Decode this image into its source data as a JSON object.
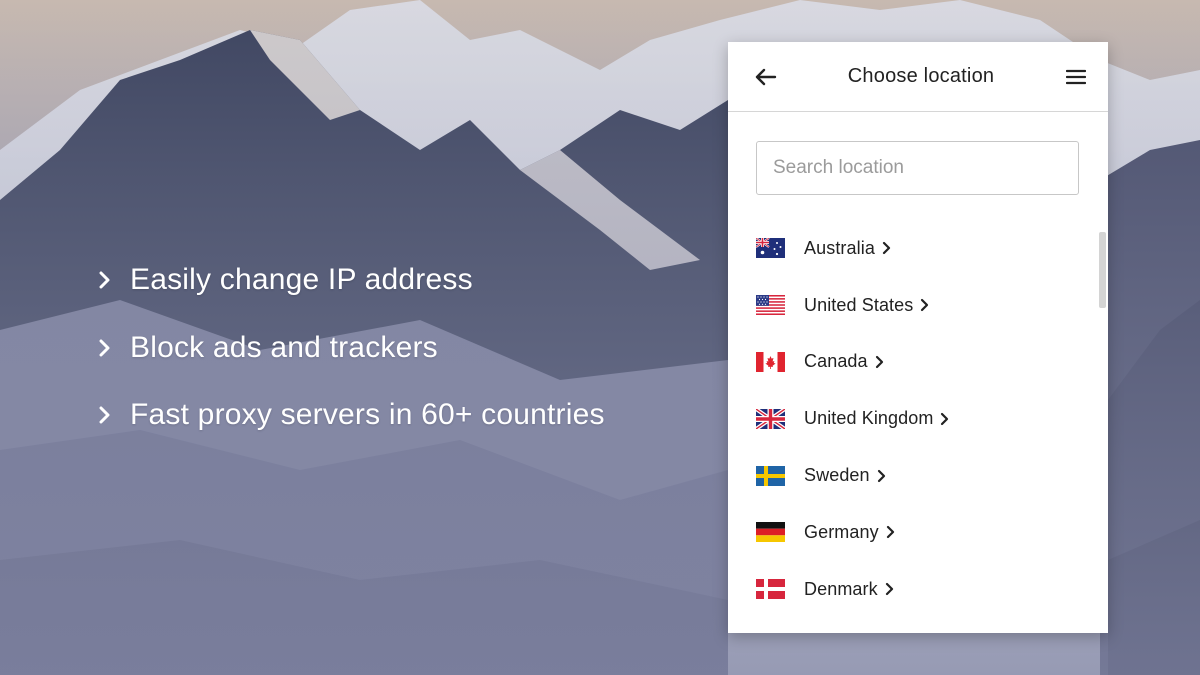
{
  "features": [
    {
      "text": "Easily change IP address"
    },
    {
      "text": "Block ads and trackers"
    },
    {
      "text": "Fast proxy servers in 60+ countries"
    }
  ],
  "panel": {
    "title": "Choose location",
    "back_icon": "arrow-left-icon",
    "menu_icon": "hamburger-menu-icon",
    "search": {
      "placeholder": "Search location",
      "value": ""
    },
    "locations": [
      {
        "name": "Australia",
        "flag": "australia-flag"
      },
      {
        "name": "United States",
        "flag": "united-states-flag"
      },
      {
        "name": "Canada",
        "flag": "canada-flag"
      },
      {
        "name": "United Kingdom",
        "flag": "united-kingdom-flag"
      },
      {
        "name": "Sweden",
        "flag": "sweden-flag"
      },
      {
        "name": "Germany",
        "flag": "germany-flag"
      },
      {
        "name": "Denmark",
        "flag": "denmark-flag"
      }
    ]
  },
  "colors": {
    "panel_bg": "#ffffff",
    "text_dark": "#222222",
    "placeholder": "#9b9b9b",
    "feature_text": "#ffffff"
  }
}
